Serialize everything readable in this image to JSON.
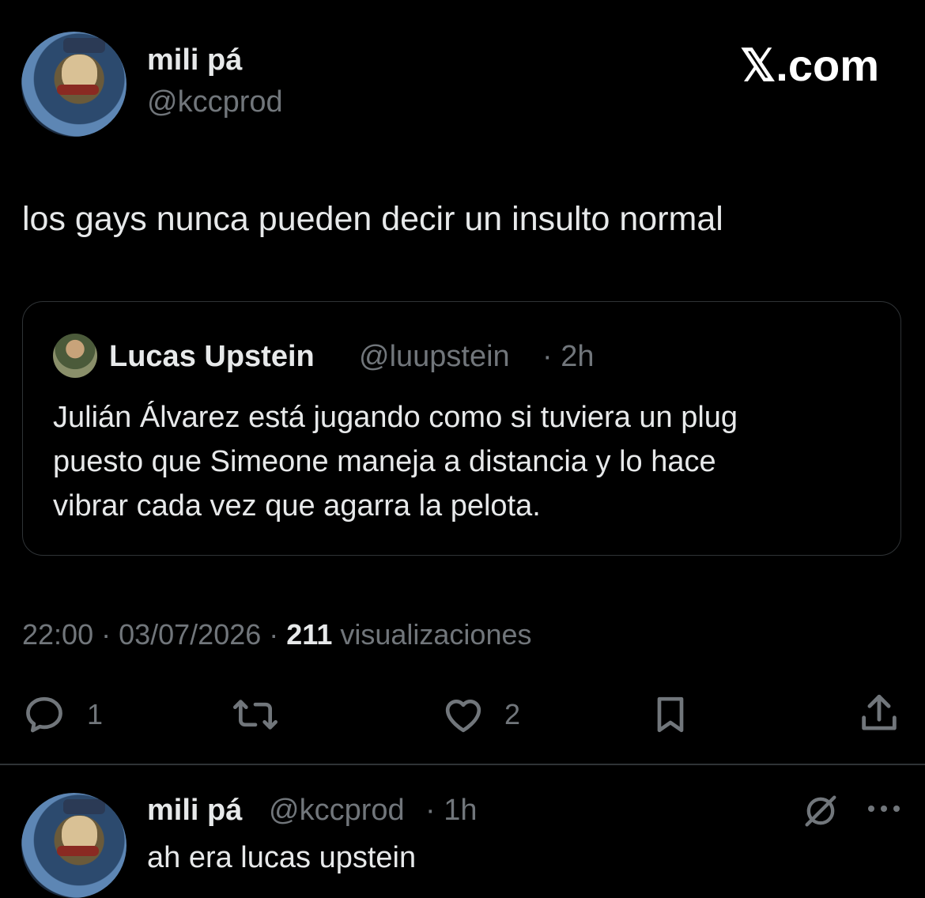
{
  "brand": {
    "logo_text": "𝕏.com"
  },
  "tweet": {
    "author_name": "mili pá",
    "author_handle": "@kccprod",
    "text": "los gays nunca pueden decir un insulto normal",
    "timestamp": "22:00 · 03/07/2026 ·",
    "views_count": "211",
    "views_label": "visualizaciones",
    "actions": {
      "reply_icon": "reply-icon",
      "reply_count": "1",
      "retweet_icon": "retweet-icon",
      "like_icon": "heart-icon",
      "like_count": "2",
      "bookmark_icon": "bookmark-icon",
      "share_icon": "share-icon"
    }
  },
  "quote": {
    "author_name": "Lucas Upstein",
    "author_handle": "@luupstein",
    "time": "· 2h",
    "text_line1": "Julián Álvarez está jugando como si tuviera un plug",
    "text_line2": "puesto que Simeone maneja a distancia y lo hace",
    "text_line3": "vibrar cada vez que agarra la pelota."
  },
  "reply": {
    "author_name": "mili pá",
    "author_handle": "@kccprod",
    "time": "· 1h",
    "text": "ah era lucas upstein",
    "grok_icon": "grok-icon",
    "more_icon": "more-icon"
  },
  "colors": {
    "background": "#000000",
    "text": "#e7e9ea",
    "muted": "#71767b",
    "border": "#2f3336"
  }
}
